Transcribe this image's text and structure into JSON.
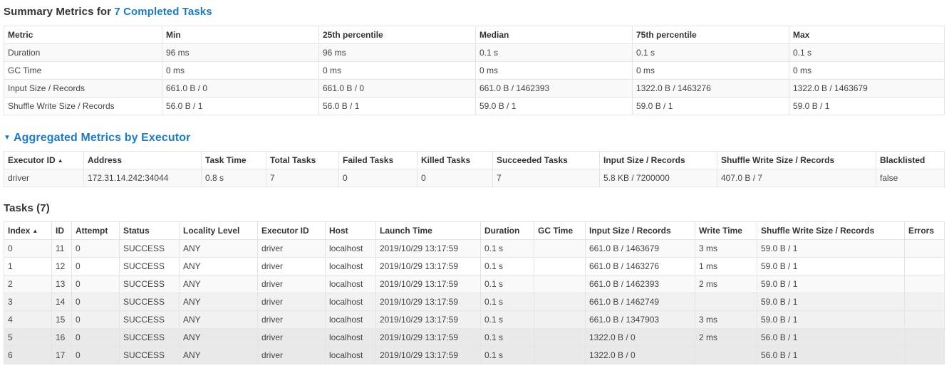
{
  "summary": {
    "title_prefix": "Summary Metrics for ",
    "title_link": "7 Completed Tasks",
    "headers": [
      "Metric",
      "Min",
      "25th percentile",
      "Median",
      "75th percentile",
      "Max"
    ],
    "rows": [
      [
        "Duration",
        "96 ms",
        "96 ms",
        "0.1 s",
        "0.1 s",
        "0.1 s"
      ],
      [
        "GC Time",
        "0 ms",
        "0 ms",
        "0 ms",
        "0 ms",
        "0 ms"
      ],
      [
        "Input Size / Records",
        "661.0 B / 0",
        "661.0 B / 0",
        "661.0 B / 1462393",
        "1322.0 B / 1463276",
        "1322.0 B / 1463679"
      ],
      [
        "Shuffle Write Size / Records",
        "56.0 B / 1",
        "56.0 B / 1",
        "59.0 B / 1",
        "59.0 B / 1",
        "59.0 B / 1"
      ]
    ]
  },
  "aggregated": {
    "title": "Aggregated Metrics by Executor",
    "headers": [
      "Executor ID",
      "Address",
      "Task Time",
      "Total Tasks",
      "Failed Tasks",
      "Killed Tasks",
      "Succeeded Tasks",
      "Input Size / Records",
      "Shuffle Write Size / Records",
      "Blacklisted"
    ],
    "rows": [
      [
        "driver",
        "172.31.14.242:34044",
        "0.8 s",
        "7",
        "0",
        "0",
        "7",
        "5.8 KB / 7200000",
        "407.0 B / 7",
        "false"
      ]
    ]
  },
  "tasks": {
    "title": "Tasks (7)",
    "headers": [
      "Index",
      "ID",
      "Attempt",
      "Status",
      "Locality Level",
      "Executor ID",
      "Host",
      "Launch Time",
      "Duration",
      "GC Time",
      "Input Size / Records",
      "Write Time",
      "Shuffle Write Size / Records",
      "Errors"
    ],
    "rows": [
      [
        "0",
        "11",
        "0",
        "SUCCESS",
        "ANY",
        "driver",
        "localhost",
        "2019/10/29 13:17:59",
        "0.1 s",
        "",
        "661.0 B / 1463679",
        "3 ms",
        "59.0 B / 1",
        ""
      ],
      [
        "1",
        "12",
        "0",
        "SUCCESS",
        "ANY",
        "driver",
        "localhost",
        "2019/10/29 13:17:59",
        "0.1 s",
        "",
        "661.0 B / 1463276",
        "1 ms",
        "59.0 B / 1",
        ""
      ],
      [
        "2",
        "13",
        "0",
        "SUCCESS",
        "ANY",
        "driver",
        "localhost",
        "2019/10/29 13:17:59",
        "0.1 s",
        "",
        "661.0 B / 1462393",
        "2 ms",
        "59.0 B / 1",
        ""
      ],
      [
        "3",
        "14",
        "0",
        "SUCCESS",
        "ANY",
        "driver",
        "localhost",
        "2019/10/29 13:17:59",
        "0.1 s",
        "",
        "661.0 B / 1462749",
        "",
        "59.0 B / 1",
        ""
      ],
      [
        "4",
        "15",
        "0",
        "SUCCESS",
        "ANY",
        "driver",
        "localhost",
        "2019/10/29 13:17:59",
        "0.1 s",
        "",
        "661.0 B / 1347903",
        "3 ms",
        "59.0 B / 1",
        ""
      ],
      [
        "5",
        "16",
        "0",
        "SUCCESS",
        "ANY",
        "driver",
        "localhost",
        "2019/10/29 13:17:59",
        "0.1 s",
        "",
        "1322.0 B / 0",
        "2 ms",
        "56.0 B / 1",
        ""
      ],
      [
        "6",
        "17",
        "0",
        "SUCCESS",
        "ANY",
        "driver",
        "localhost",
        "2019/10/29 13:17:59",
        "0.1 s",
        "",
        "1322.0 B / 0",
        "",
        "56.0 B / 1",
        ""
      ]
    ]
  },
  "icons": {
    "sort_ascending": "▲",
    "collapse_arrow": "▼"
  },
  "colors": {
    "link": "#1f7bbd",
    "row_stripe": "#f9f9f9",
    "border": "#e4e4e4"
  }
}
